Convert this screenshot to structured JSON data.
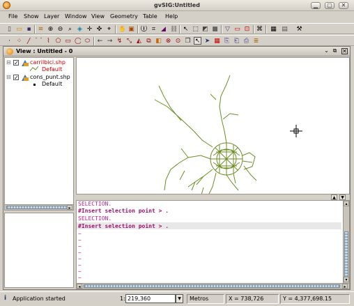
{
  "window": {
    "title": "gvSIG:Untitled",
    "min_label": "▁",
    "max_label": "▢",
    "close_label": "✕"
  },
  "menu": [
    "File",
    "Show",
    "Layer",
    "Window",
    "View",
    "Geometry",
    "Table",
    "Help"
  ],
  "view": {
    "title": "View : Untitled - 0"
  },
  "toc": {
    "layers": [
      {
        "name": "carrilbici.shp",
        "checked": true,
        "legend": "Default",
        "color": "#6b8e23",
        "name_color": "#cc0000"
      },
      {
        "name": "cons_punt.shp",
        "checked": true,
        "legend": "Default",
        "color": "#000000",
        "name_color": "#000000"
      }
    ]
  },
  "console": {
    "lines": [
      {
        "text": "SELECTION.",
        "kind": "selection"
      },
      {
        "text": "#Insert selection point > .",
        "kind": "insert"
      },
      {
        "text": "SELECTION.",
        "kind": "selection"
      },
      {
        "text": "#Insert selection point > .",
        "kind": "insert"
      },
      {
        "text": "~",
        "kind": "tilde"
      },
      {
        "text": "~",
        "kind": "tilde"
      },
      {
        "text": "~",
        "kind": "tilde"
      },
      {
        "text": "~",
        "kind": "tilde"
      },
      {
        "text": "~",
        "kind": "tilde"
      },
      {
        "text": "~",
        "kind": "tilde"
      },
      {
        "text": "~",
        "kind": "tilde"
      },
      {
        "text": "~",
        "kind": "tilde"
      }
    ]
  },
  "status": {
    "message": "Application started",
    "scale_prefix": "1:",
    "scale_value": "219,360",
    "units": "Metros",
    "x": "X = 738,726",
    "y": "Y = 4,377,698.15"
  },
  "colors": {
    "map_lines": "#6b8e23",
    "console_keyword": "#c22090"
  }
}
